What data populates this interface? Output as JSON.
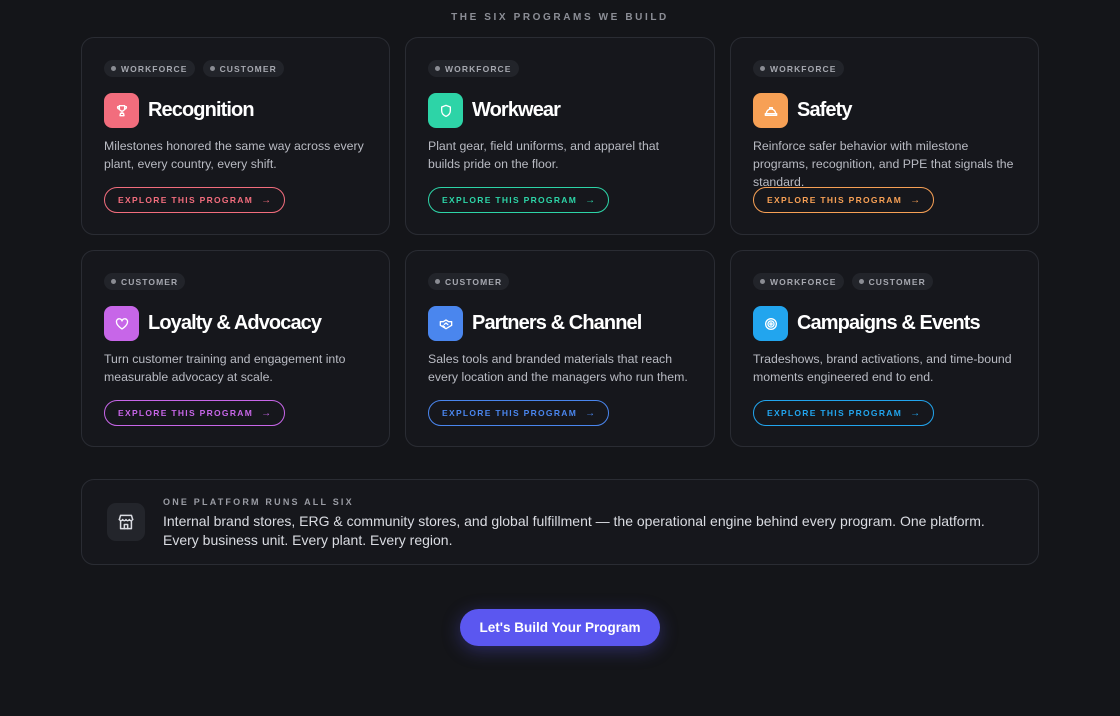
{
  "section": {
    "eyebrow": "THE SIX PROGRAMS WE BUILD"
  },
  "programs": [
    {
      "tags": [
        "WORKFORCE",
        "CUSTOMER"
      ],
      "icon": "trophy-icon",
      "accent": "#f26d7d",
      "title": "Recognition",
      "description": "Milestones honored the same way across every plant, every country, every shift.",
      "cta": "EXPLORE THIS PROGRAM",
      "cta_arrow": "→"
    },
    {
      "tags": [
        "WORKFORCE"
      ],
      "icon": "shield-icon",
      "accent": "#2dd4a7",
      "title": "Workwear",
      "description": "Plant gear, field uniforms, and apparel that builds pride on the floor.",
      "cta": "EXPLORE THIS PROGRAM",
      "cta_arrow": "→"
    },
    {
      "tags": [
        "WORKFORCE"
      ],
      "icon": "hard-hat-icon",
      "accent": "#f7a055",
      "title": "Safety",
      "description": "Reinforce safer behavior with milestone programs, recognition, and PPE that signals the standard.",
      "cta": "EXPLORE THIS PROGRAM",
      "cta_arrow": "→"
    },
    {
      "tags": [
        "CUSTOMER"
      ],
      "icon": "heart-icon",
      "accent": "#c766e8",
      "title": "Loyalty & Advocacy",
      "description": "Turn customer training and engagement into measurable advocacy at scale.",
      "cta": "EXPLORE THIS PROGRAM",
      "cta_arrow": "→"
    },
    {
      "tags": [
        "CUSTOMER"
      ],
      "icon": "handshake-icon",
      "accent": "#4a86ee",
      "title": "Partners & Channel",
      "description": "Sales tools and branded materials that reach every location and the managers who run them.",
      "cta": "EXPLORE THIS PROGRAM",
      "cta_arrow": "→"
    },
    {
      "tags": [
        "WORKFORCE",
        "CUSTOMER"
      ],
      "icon": "target-icon",
      "accent": "#22a5ee",
      "title": "Campaigns & Events",
      "description": "Tradeshows, brand activations, and time-bound moments engineered end to end.",
      "cta": "EXPLORE THIS PROGRAM",
      "cta_arrow": "→"
    }
  ],
  "platform": {
    "icon": "storefront-icon",
    "eyebrow": "ONE PLATFORM RUNS ALL SIX",
    "text": "Internal brand stores, ERG & community stores, and global fulfillment — the operational engine behind every program. One platform. Every business unit. Every plant. Every region."
  },
  "cta": {
    "label": "Let's Build Your Program",
    "color": "#5b57f0"
  }
}
